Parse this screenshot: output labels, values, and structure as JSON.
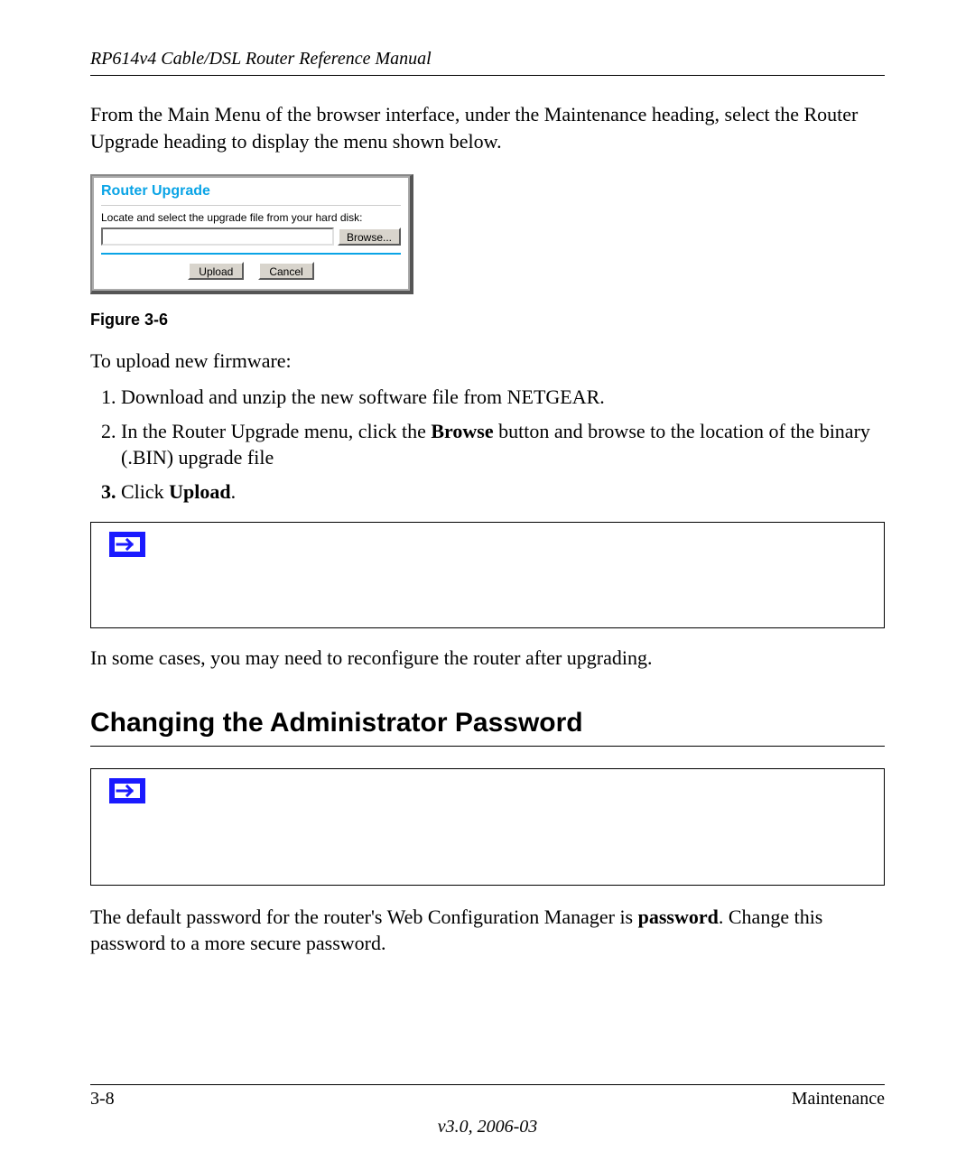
{
  "header": {
    "running_head": "RP614v4 Cable/DSL Router Reference Manual"
  },
  "intro_para": "From the Main Menu of the browser interface, under the Maintenance heading, select the Router Upgrade heading to display the menu shown below.",
  "panel": {
    "title": "Router Upgrade",
    "instruction": "Locate and select the upgrade file from your hard disk:",
    "browse_label": "Browse...",
    "upload_label": "Upload",
    "cancel_label": "Cancel"
  },
  "figure_caption": "Figure 3-6",
  "upload_intro": "To upload new firmware:",
  "steps": {
    "s1": "Download and unzip the new software file from NETGEAR.",
    "s2_a": "In the Router Upgrade menu, click the ",
    "s2_bold": "Browse",
    "s2_b": " button and browse to the location of the binary (.BIN) upgrade file",
    "s3_a": "Click ",
    "s3_bold": "Upload",
    "s3_b": "."
  },
  "post_para": "In some cases, you may need to reconfigure the router after upgrading.",
  "section_heading": "Changing the Administrator Password",
  "pwd_para_a": "The default password for the router's Web Configuration Manager is ",
  "pwd_para_bold": "password",
  "pwd_para_b": ". Change this password to a more secure password.",
  "footer": {
    "page_num": "3-8",
    "section": "Maintenance",
    "version": "v3.0, 2006-03"
  }
}
